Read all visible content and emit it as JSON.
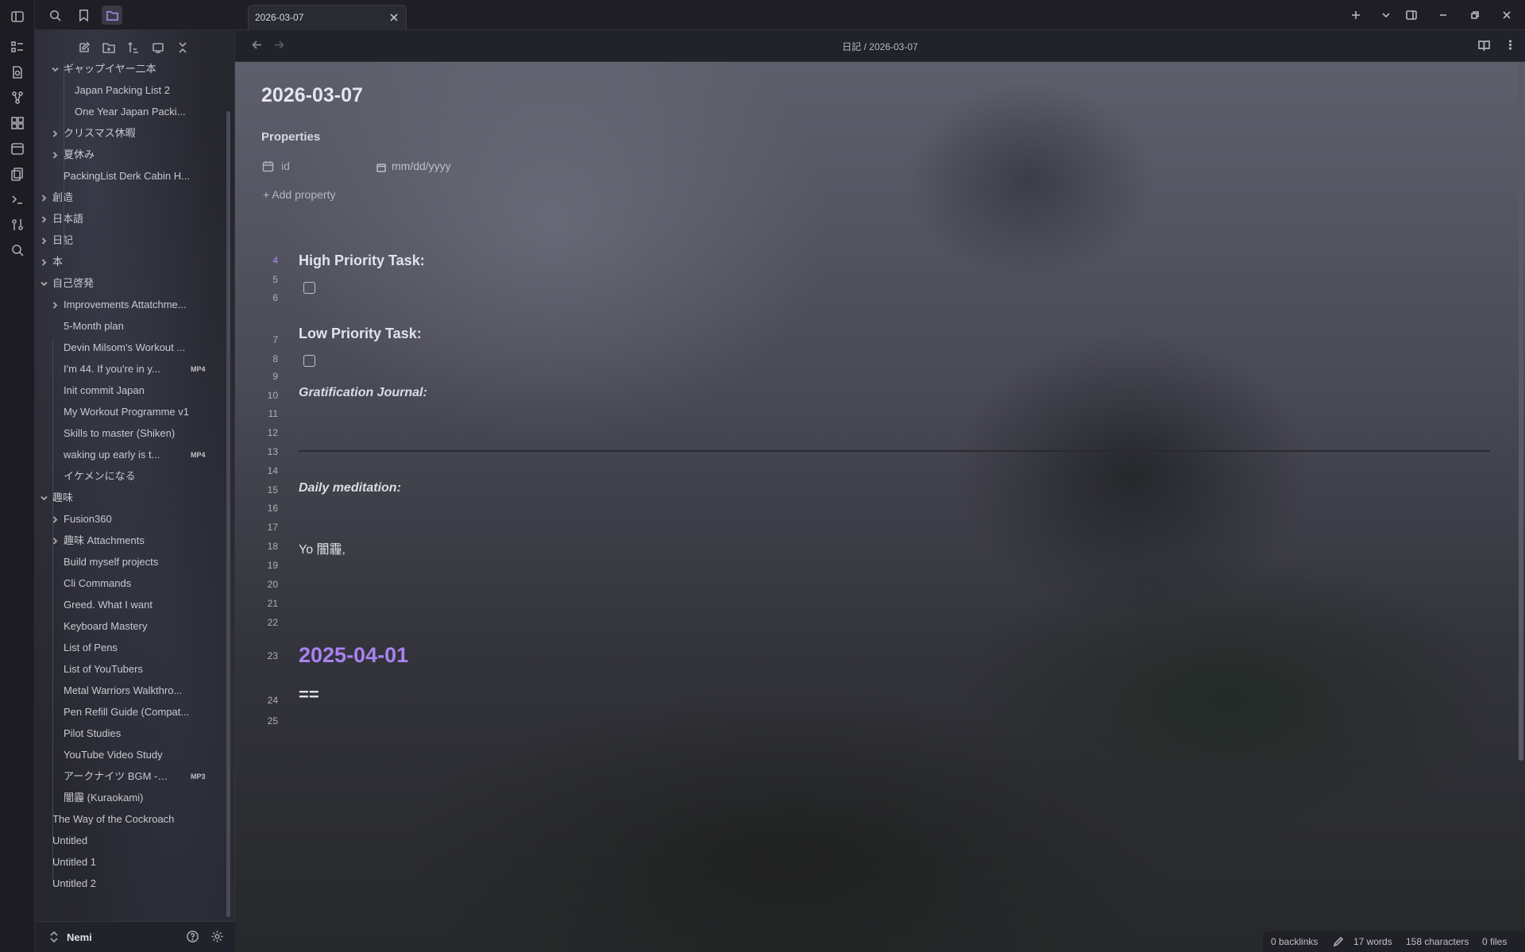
{
  "ribbon": {
    "icons": [
      "sidebar-toggle-icon",
      "outline-icon",
      "file-search-icon",
      "graph-icon",
      "canvas-icon",
      "calendar-icon",
      "pages-icon",
      "terminal-icon",
      "command-icon",
      "search-icon"
    ]
  },
  "sidebar": {
    "tree": [
      {
        "label": "ギャップイヤー二本",
        "level": 1,
        "chevron": "down"
      },
      {
        "label": "Japan Packing List 2",
        "level": 2
      },
      {
        "label": "One Year Japan Packi...",
        "level": 2
      },
      {
        "label": "クリスマス休暇",
        "level": 1,
        "chevron": "right"
      },
      {
        "label": "夏休み",
        "level": 1,
        "chevron": "right"
      },
      {
        "label": "PackingList Derk Cabin H...",
        "level": 1
      },
      {
        "label": "創造",
        "level": 0,
        "chevron": "right"
      },
      {
        "label": "日本語",
        "level": 0,
        "chevron": "right"
      },
      {
        "label": "日記",
        "level": 0,
        "chevron": "right"
      },
      {
        "label": "本",
        "level": 0,
        "chevron": "right"
      },
      {
        "label": "自己啓発",
        "level": 0,
        "chevron": "down"
      },
      {
        "label": "Improvements Attatchme...",
        "level": 1,
        "chevron": "right"
      },
      {
        "label": "5-Month plan",
        "level": 1
      },
      {
        "label": "Devin Milsom's Workout ...",
        "level": 1
      },
      {
        "label": "I'm 44. If you're in y...",
        "level": 1,
        "badge": "MP4"
      },
      {
        "label": "Init commit Japan",
        "level": 1
      },
      {
        "label": "My Workout Programme v1",
        "level": 1
      },
      {
        "label": "Skills to master (Shiken)",
        "level": 1
      },
      {
        "label": "waking up early is t...",
        "level": 1,
        "badge": "MP4"
      },
      {
        "label": "イケメンになる",
        "level": 1
      },
      {
        "label": "趣味",
        "level": 0,
        "chevron": "down"
      },
      {
        "label": "Fusion360",
        "level": 1,
        "chevron": "right"
      },
      {
        "label": "趣味 Attachments",
        "level": 1,
        "chevron": "right"
      },
      {
        "label": "Build myself projects",
        "level": 1
      },
      {
        "label": "Cli Commands",
        "level": 1
      },
      {
        "label": "Greed. What I want",
        "level": 1
      },
      {
        "label": "Keyboard Mastery",
        "level": 1
      },
      {
        "label": "List of Pens",
        "level": 1
      },
      {
        "label": "List of YouTubers",
        "level": 1
      },
      {
        "label": "Metal Warriors Walkthro...",
        "level": 1
      },
      {
        "label": "Pen Refill Guide (Compat...",
        "level": 1
      },
      {
        "label": "Pilot Studies",
        "level": 1
      },
      {
        "label": "YouTube Video Study",
        "level": 1
      },
      {
        "label": "アークナイツ BGM - ...",
        "level": 1,
        "badge": "MP3"
      },
      {
        "label": "闇霾 (Kuraokami)",
        "level": 1
      },
      {
        "label": "The Way of the Cockroach",
        "level": 0
      },
      {
        "label": "Untitled",
        "level": 0
      },
      {
        "label": "Untitled 1",
        "level": 0
      },
      {
        "label": "Untitled 2",
        "level": 0
      }
    ],
    "vault_name": "Nemi"
  },
  "tab": {
    "title": "2026-03-07"
  },
  "breadcrumb": "日記 / 2026-03-07",
  "doc": {
    "title": "2026-03-07",
    "properties_label": "Properties",
    "property_key": "id",
    "property_value": "mm/dd/yyyy",
    "add_property": "Add property",
    "lines": [
      {
        "n": "4",
        "active": true
      },
      {
        "n": "5"
      },
      {
        "n": "6"
      },
      {
        "n": "7"
      },
      {
        "n": "8"
      },
      {
        "n": "9"
      },
      {
        "n": "10"
      },
      {
        "n": "11"
      },
      {
        "n": "12"
      },
      {
        "n": "13"
      },
      {
        "n": "14"
      },
      {
        "n": "15"
      },
      {
        "n": "16"
      },
      {
        "n": "17"
      },
      {
        "n": "18"
      },
      {
        "n": "19"
      },
      {
        "n": "20"
      },
      {
        "n": "21"
      },
      {
        "n": "22"
      },
      {
        "n": "23"
      },
      {
        "n": "24"
      },
      {
        "n": "25"
      }
    ],
    "high_priority": "High Priority Task:",
    "low_priority": "Low Priority Task:",
    "gratification": "Gratification Journal:",
    "meditation": "Daily meditation:",
    "greeting": "Yo 闇霾,",
    "date_heading": "2025-04-01",
    "equals": "=="
  },
  "status": {
    "backlinks": "0 backlinks",
    "words": "17 words",
    "characters": "158 characters",
    "files": "0 files"
  },
  "colors": {
    "accent": "#a882f0"
  }
}
